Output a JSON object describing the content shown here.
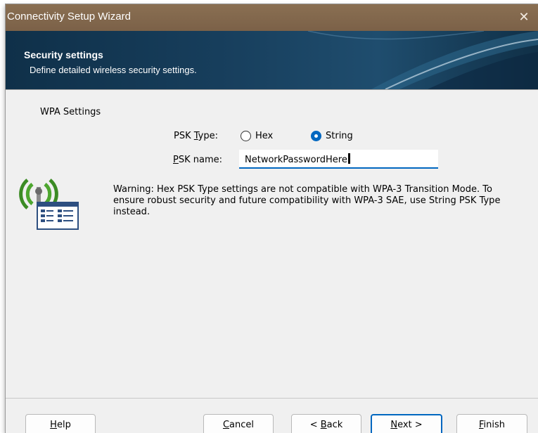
{
  "window": {
    "title": "Connectivity Setup Wizard",
    "close_glyph": "✕"
  },
  "banner": {
    "heading": "Security settings",
    "subheading": "Define detailed wireless security settings."
  },
  "group": {
    "label": "WPA Settings"
  },
  "psk_type": {
    "label_prefix": "PSK ",
    "label_mnemonic": "T",
    "label_suffix": "ype:",
    "options": [
      {
        "label": "Hex",
        "selected": false
      },
      {
        "label": "String",
        "selected": true
      }
    ]
  },
  "psk_name": {
    "label_mnemonic": "P",
    "label_suffix": "SK name:",
    "value": "NetworkPasswordHere"
  },
  "warning": {
    "text": "Warning: Hex PSK Type settings are not compatible with WPA-3 Transition Mode. To ensure robust security and future compatibility with WPA-3 SAE, use String PSK Type instead."
  },
  "buttons": {
    "help": {
      "mnemonic": "H",
      "rest": "elp"
    },
    "cancel": {
      "mnemonic": "C",
      "rest": "ancel"
    },
    "back": {
      "prefix": "< ",
      "mnemonic": "B",
      "rest": "ack"
    },
    "next": {
      "mnemonic": "N",
      "rest": "ext >"
    },
    "finish": {
      "mnemonic": "F",
      "rest": "inish"
    }
  },
  "icons": {
    "wizard": "wireless-settings-icon",
    "close": "close-icon"
  },
  "colors": {
    "title_bar": "#7b6148",
    "banner": "#173e5c",
    "accent": "#0067c0"
  }
}
